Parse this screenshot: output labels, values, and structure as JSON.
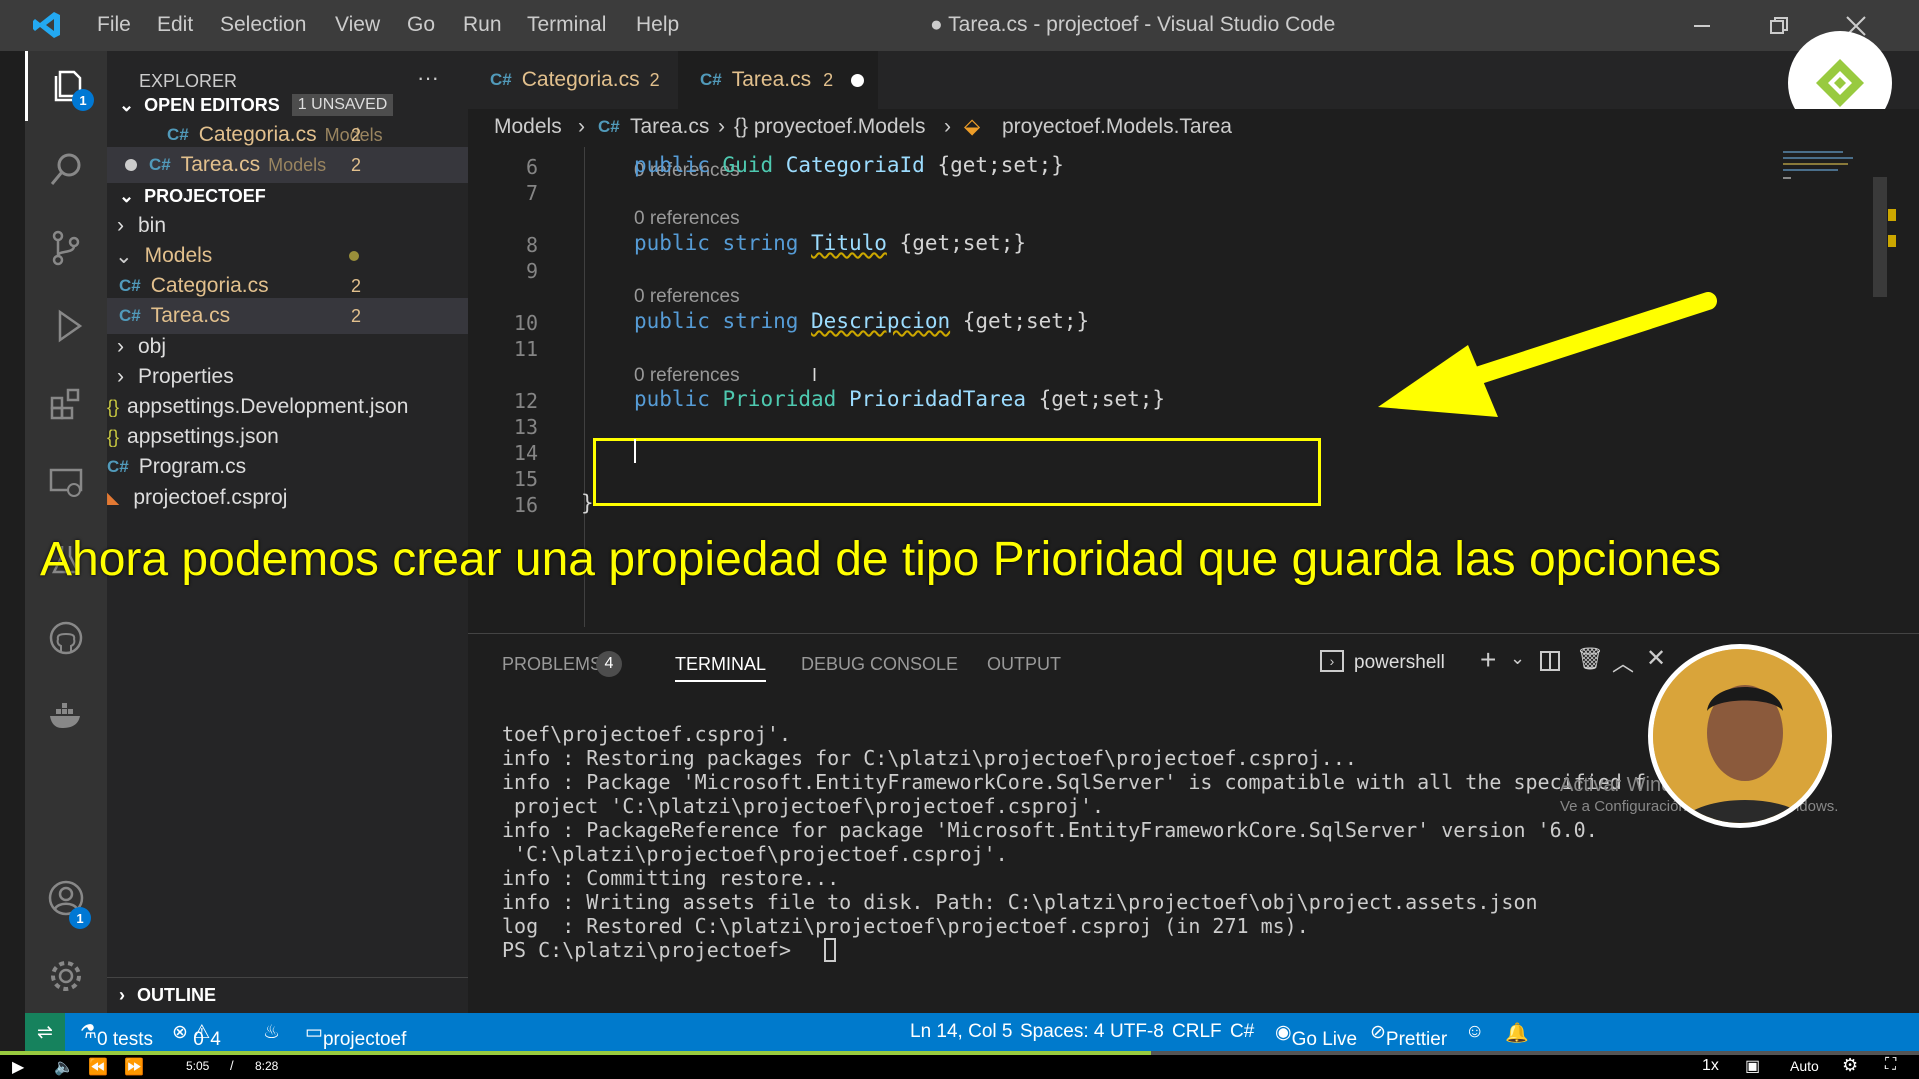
{
  "window": {
    "title": "● Tarea.cs - projectoef - Visual Studio Code",
    "menu": [
      "File",
      "Edit",
      "Selection",
      "View",
      "Go",
      "Run",
      "Terminal",
      "Help"
    ]
  },
  "activity": {
    "explorer_badge": "1",
    "accounts_badge": "1"
  },
  "sidebar": {
    "title": "EXPLORER",
    "more": "···",
    "open_editors": {
      "label": "OPEN EDITORS",
      "badge": "1 UNSAVED",
      "items": [
        {
          "icon": "C#",
          "name": "Categoria.cs",
          "folder": "Models",
          "count": "2"
        },
        {
          "icon": "C#",
          "name": "Tarea.cs",
          "folder": "Models",
          "count": "2"
        }
      ]
    },
    "project": {
      "label": "PROJECTOEF",
      "items": [
        {
          "name": "bin"
        },
        {
          "name": "Models"
        },
        {
          "icon": "C#",
          "name": "Categoria.cs",
          "count": "2"
        },
        {
          "icon": "C#",
          "name": "Tarea.cs",
          "count": "2"
        },
        {
          "name": "obj"
        },
        {
          "name": "Properties"
        },
        {
          "icon": "{}",
          "name": "appsettings.Development.json"
        },
        {
          "icon": "{}",
          "name": "appsettings.json"
        },
        {
          "icon": "C#",
          "name": "Program.cs"
        },
        {
          "name": "projectoef.csproj"
        }
      ]
    },
    "outline": "OUTLINE"
  },
  "tabs": [
    {
      "icon": "C#",
      "name": "Categoria.cs",
      "count": "2"
    },
    {
      "icon": "C#",
      "name": "Tarea.cs",
      "count": "2"
    }
  ],
  "breadcrumb": [
    "Models",
    "Tarea.cs",
    "{} proyectoef.Models",
    "proyectoef.Models.Tarea"
  ],
  "editor": {
    "refs": "0 references",
    "line_numbers": [
      "6",
      "7",
      "8",
      "9",
      "10",
      "11",
      "12",
      "13",
      "14",
      "15",
      "16"
    ],
    "lines": {
      "l6": {
        "kw": "public",
        "type": "Guid",
        "name": "CategoriaId",
        "acc": "{get;set;}"
      },
      "l8": {
        "kw": "public",
        "type": "string",
        "name": "Titulo",
        "acc": "{get;set;}"
      },
      "l10": {
        "kw": "public",
        "type": "string",
        "name": "Descripcion",
        "acc": "{get;set;}"
      },
      "l12": {
        "kw": "public",
        "type": "Prioridad",
        "name": "PrioridadTarea",
        "acc": "{get;set;}"
      },
      "l16": "}"
    }
  },
  "caption": "Ahora podemos crear una propiedad de tipo Prioridad que guarda las opciones",
  "panel": {
    "tabs": [
      "PROBLEMS",
      "TERMINAL",
      "DEBUG CONSOLE",
      "OUTPUT"
    ],
    "problems_count": "4",
    "shell": "powershell",
    "terminal_lines": [
      "toef\\projectoef.csproj'.",
      "info : Restoring packages for C:\\platzi\\projectoef\\projectoef.csproj...",
      "info : Package 'Microsoft.EntityFrameworkCore.SqlServer' is compatible with all the specified f",
      " project 'C:\\platzi\\projectoef\\projectoef.csproj'.",
      "info : PackageReference for package 'Microsoft.EntityFrameworkCore.SqlServer' version '6.0.",
      " 'C:\\platzi\\projectoef\\projectoef.csproj'.",
      "info : Committing restore...",
      "info : Writing assets file to disk. Path: C:\\platzi\\projectoef\\obj\\project.assets.json",
      "log  : Restored C:\\platzi\\projectoef\\projectoef.csproj (in 271 ms).",
      "PS C:\\platzi\\projectoef> "
    ]
  },
  "watermark": {
    "line1": "Activar Windows",
    "line2": "Ve a Configuración para activar Windows."
  },
  "status": {
    "tests": "0 tests",
    "errors": "0",
    "warnings": "4",
    "folder": "projectoef",
    "position": "Ln 14, Col 5",
    "spaces": "Spaces: 4",
    "encoding": "UTF-8",
    "eol": "CRLF",
    "lang": "C#",
    "golive": "Go Live",
    "prettier": "Prettier"
  },
  "player": {
    "current": "5:05",
    "sep": "/",
    "total": "8:28",
    "speed": "1x",
    "quality": "Auto"
  }
}
